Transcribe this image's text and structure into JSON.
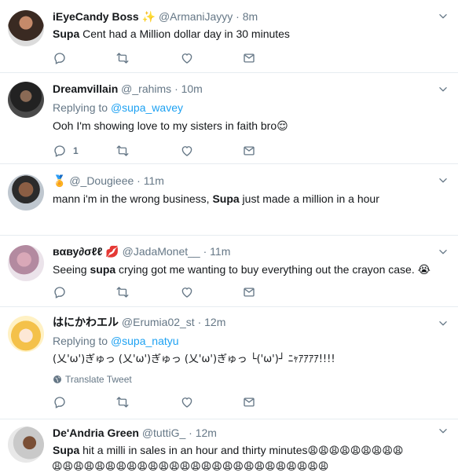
{
  "tweets": [
    {
      "name": "iEyeCandy Boss",
      "handle": "@ArmaniJayyy",
      "time": "· 8m",
      "text_bold": "Supa",
      "text_rest": " Cent had a Million dollar day in 30 minutes"
    },
    {
      "name": "Dreamvillain",
      "handle": "@_rahims",
      "time": "· 10m",
      "replying_label": "Replying to ",
      "replying_user": "@supa_wavey",
      "text": "Ooh I'm showing love to my sisters in faith bro",
      "emoji": "😌",
      "reply_count": "1"
    },
    {
      "name": "",
      "name_emoji": "🏅",
      "handle": "@_Dougieee",
      "time": "· 11m",
      "text_pre": "mann i'm in the wrong business, ",
      "text_bold": "Supa",
      "text_post": " just made a million in a hour"
    },
    {
      "name": "вαву∂σℓℓ",
      "name_emoji": "💋",
      "handle": "@JadaMonet__",
      "time": "· 11m",
      "text_pre": "Seeing ",
      "text_bold": "supa",
      "text_post": " crying got me wanting to buy everything out the crayon case.",
      "emoji": "😭"
    },
    {
      "name": "はにかわエル",
      "handle": "@Erumia02_st",
      "time": "· 12m",
      "replying_label": "Replying to ",
      "replying_user": "@supa_natyu",
      "text": "(乂'ω')ぎゅっ (乂'ω')ぎゅっ (乂'ω')ぎゅっ └('ω')┘ ﾆｬｱｱｱｱ!!!!",
      "translate_label": "Translate Tweet"
    },
    {
      "name": "De'Andria Green",
      "handle": "@tuttiG_",
      "time": "· 12m",
      "text_bold": "Supa",
      "text_rest": " hit a milli in sales in an hour and thirty minutes",
      "emoji_line1": "😩😩😩😩😩😩😩😩😩",
      "emoji_line2": "😩😩😩😩😩😩😩😩😩😩😩😩😩😩😩😩😩😩😩😩😩😩😩😩😩😩"
    }
  ],
  "colors": {
    "accent": "#1da1f2",
    "secondary_text": "#657786",
    "divider": "#e6ecf0",
    "icon": "#657786"
  }
}
